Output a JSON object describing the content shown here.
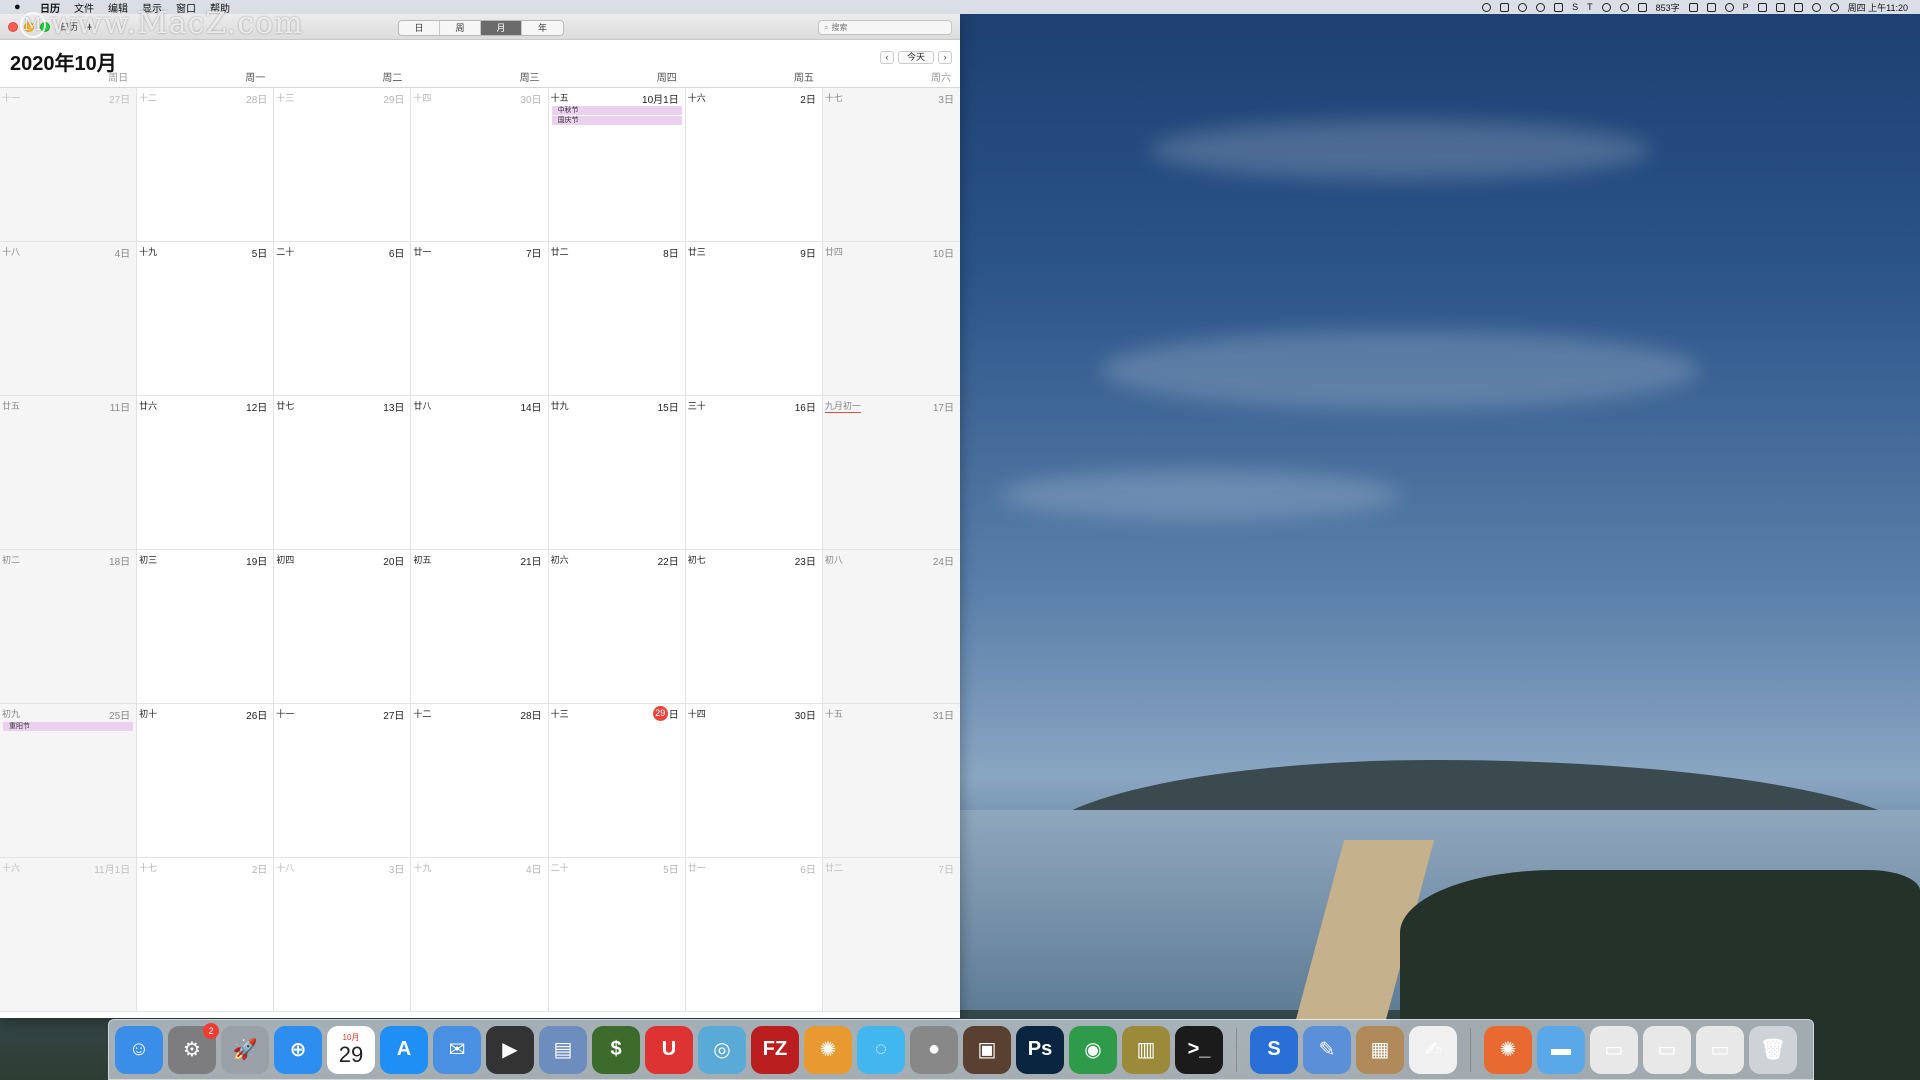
{
  "menubar": {
    "apple": "",
    "items": [
      "日历",
      "文件",
      "编辑",
      "显示",
      "窗口",
      "帮助"
    ],
    "tray_text_1": "853字",
    "clock": "周四 上午11:20"
  },
  "watermark": {
    "logo": "M",
    "text": "www.MacZ.com"
  },
  "toolbar": {
    "calendars_label": "日历",
    "add_label": "+",
    "views": [
      {
        "label": "日",
        "active": false
      },
      {
        "label": "周",
        "active": false
      },
      {
        "label": "月",
        "active": true
      },
      {
        "label": "年",
        "active": false
      }
    ],
    "search_placeholder": "搜索"
  },
  "header": {
    "month_title": "2020年10月",
    "prev": "‹",
    "today": "今天",
    "next": "›"
  },
  "weekdays": [
    "周日",
    "周一",
    "周二",
    "周三",
    "周四",
    "周五",
    "周六"
  ],
  "weeks": [
    [
      {
        "lunar": "十一",
        "day": "27日",
        "other": true
      },
      {
        "lunar": "十二",
        "day": "28日",
        "other": true
      },
      {
        "lunar": "十三",
        "day": "29日",
        "other": true
      },
      {
        "lunar": "十四",
        "day": "30日",
        "other": true
      },
      {
        "lunar": "十五",
        "day": "10月1日",
        "other": false,
        "events": [
          "中秋节",
          "国庆节"
        ]
      },
      {
        "lunar": "十六",
        "day": "2日",
        "other": false
      },
      {
        "lunar": "十七",
        "day": "3日",
        "other": false
      }
    ],
    [
      {
        "lunar": "十八",
        "day": "4日",
        "other": false
      },
      {
        "lunar": "十九",
        "day": "5日",
        "other": false
      },
      {
        "lunar": "二十",
        "day": "6日",
        "other": false
      },
      {
        "lunar": "廿一",
        "day": "7日",
        "other": false
      },
      {
        "lunar": "廿二",
        "day": "8日",
        "other": false
      },
      {
        "lunar": "廿三",
        "day": "9日",
        "other": false
      },
      {
        "lunar": "廿四",
        "day": "10日",
        "other": false
      }
    ],
    [
      {
        "lunar": "廿五",
        "day": "11日",
        "other": false
      },
      {
        "lunar": "廿六",
        "day": "12日",
        "other": false
      },
      {
        "lunar": "廿七",
        "day": "13日",
        "other": false
      },
      {
        "lunar": "廿八",
        "day": "14日",
        "other": false
      },
      {
        "lunar": "廿九",
        "day": "15日",
        "other": false
      },
      {
        "lunar": "三十",
        "day": "16日",
        "other": false
      },
      {
        "lunar": "九月初一",
        "day": "17日",
        "other": false,
        "underline": true
      }
    ],
    [
      {
        "lunar": "初二",
        "day": "18日",
        "other": false
      },
      {
        "lunar": "初三",
        "day": "19日",
        "other": false
      },
      {
        "lunar": "初四",
        "day": "20日",
        "other": false
      },
      {
        "lunar": "初五",
        "day": "21日",
        "other": false
      },
      {
        "lunar": "初六",
        "day": "22日",
        "other": false
      },
      {
        "lunar": "初七",
        "day": "23日",
        "other": false
      },
      {
        "lunar": "初八",
        "day": "24日",
        "other": false
      }
    ],
    [
      {
        "lunar": "初九",
        "day": "25日",
        "other": false,
        "events": [
          "重阳节"
        ]
      },
      {
        "lunar": "初十",
        "day": "26日",
        "other": false
      },
      {
        "lunar": "十一",
        "day": "27日",
        "other": false
      },
      {
        "lunar": "十二",
        "day": "28日",
        "other": false
      },
      {
        "lunar": "十三",
        "day": "日",
        "today_num": "29",
        "other": false
      },
      {
        "lunar": "十四",
        "day": "30日",
        "other": false
      },
      {
        "lunar": "十五",
        "day": "31日",
        "other": false
      }
    ],
    [
      {
        "lunar": "十六",
        "day": "11月1日",
        "other": true
      },
      {
        "lunar": "十七",
        "day": "2日",
        "other": true
      },
      {
        "lunar": "十八",
        "day": "3日",
        "other": true
      },
      {
        "lunar": "十九",
        "day": "4日",
        "other": true
      },
      {
        "lunar": "二十",
        "day": "5日",
        "other": true
      },
      {
        "lunar": "廿一",
        "day": "6日",
        "other": true
      },
      {
        "lunar": "廿二",
        "day": "7日",
        "other": true
      }
    ]
  ],
  "dock": {
    "items": [
      {
        "name": "finder",
        "color": "#3b8ee8",
        "glyph": "☺"
      },
      {
        "name": "system-preferences",
        "color": "#7d7d80",
        "glyph": "⚙",
        "badge": "2"
      },
      {
        "name": "launchpad",
        "color": "#9aa0a8",
        "glyph": "🚀"
      },
      {
        "name": "safari",
        "color": "#2d8ef0",
        "glyph": "⊕"
      },
      {
        "name": "calendar",
        "calendar_month": "10月",
        "calendar_day": "29"
      },
      {
        "name": "app-store",
        "color": "#1f8ff5",
        "glyph": "A"
      },
      {
        "name": "mail-app",
        "color": "#4a90e2",
        "glyph": "✉"
      },
      {
        "name": "final-cut",
        "color": "#333",
        "glyph": "▶"
      },
      {
        "name": "preview",
        "color": "#6d8dbf",
        "glyph": "▤"
      },
      {
        "name": "money-app",
        "color": "#3c6b2b",
        "glyph": "$"
      },
      {
        "name": "magnet",
        "color": "#d33",
        "glyph": "U"
      },
      {
        "name": "vpn-app",
        "color": "#5aaad8",
        "glyph": "◎"
      },
      {
        "name": "filezilla",
        "color": "#bb1e1e",
        "glyph": "FZ"
      },
      {
        "name": "color-wheel",
        "color": "#e89a30",
        "glyph": "✺"
      },
      {
        "name": "messages-app",
        "color": "#42b6ee",
        "glyph": "◌"
      },
      {
        "name": "screen-recorder",
        "color": "#888",
        "glyph": "●"
      },
      {
        "name": "photo-booth",
        "color": "#5a4030",
        "glyph": "▣"
      },
      {
        "name": "photoshop",
        "color": "#0a2540",
        "glyph": "Ps"
      },
      {
        "name": "chrome",
        "color": "#2f9a49",
        "glyph": "◉"
      },
      {
        "name": "notebook",
        "color": "#9a8a3a",
        "glyph": "▥"
      },
      {
        "name": "terminal",
        "color": "#1b1b1b",
        "glyph": ">_"
      },
      {
        "name": "s-app",
        "color": "#2a6fd6",
        "glyph": "S"
      },
      {
        "name": "xcode-like",
        "color": "#5b8fd8",
        "glyph": "✎"
      },
      {
        "name": "archive-utility",
        "color": "#b08a5a",
        "glyph": "▦"
      },
      {
        "name": "textedit",
        "color": "#f0f0f0",
        "glyph": "✍"
      },
      {
        "name": "color-wheel-2",
        "color": "#e86a30",
        "glyph": "✺"
      },
      {
        "name": "folder",
        "color": "#5aa8e8",
        "glyph": "▬"
      },
      {
        "name": "window-thumb-1",
        "color": "#e8e8e8",
        "glyph": "▭"
      },
      {
        "name": "window-thumb-2",
        "color": "#e8e8e8",
        "glyph": "▭"
      },
      {
        "name": "window-thumb-3",
        "color": "#e8e8e8",
        "glyph": "▭"
      },
      {
        "name": "trash",
        "color": "#cfd3d8",
        "glyph": "🗑"
      }
    ]
  }
}
